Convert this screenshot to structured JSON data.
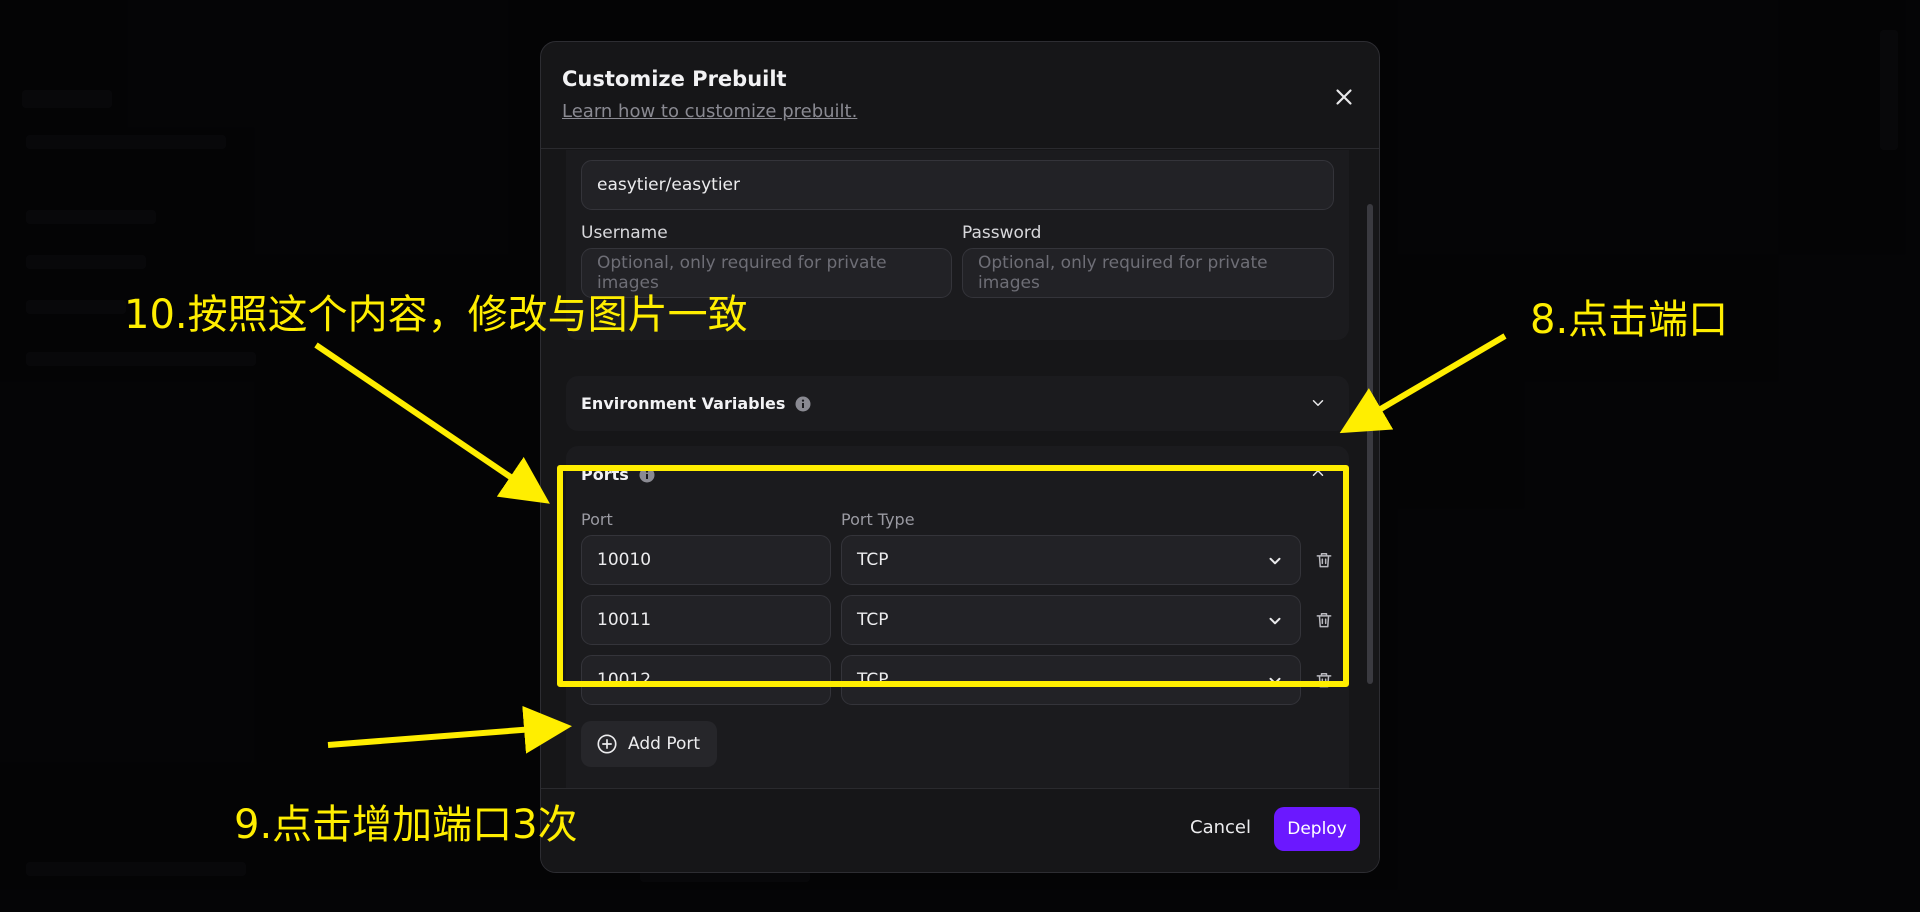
{
  "modal": {
    "title": "Customize Prebuilt",
    "help_link": "Learn how to customize prebuilt.",
    "image_value": "easytier/easytier",
    "username_label": "Username",
    "username_placeholder": "Optional, only required for private images",
    "password_label": "Password",
    "password_placeholder": "Optional, only required for private images",
    "env_section": "Environment Variables",
    "ports_section": "Ports",
    "port_col": "Port",
    "port_type_col": "Port Type",
    "ports": [
      {
        "port": "10010",
        "type": "TCP"
      },
      {
        "port": "10011",
        "type": "TCP"
      },
      {
        "port": "10012",
        "type": "TCP"
      }
    ],
    "add_port": "Add Port",
    "cancel": "Cancel",
    "deploy": "Deploy"
  },
  "annotations": {
    "step10": "10.按照这个内容，修改与图片一致",
    "step8": "8.点击端口",
    "step9": "9.点击增加端口3次"
  },
  "colors": {
    "accent": "#6b18ff",
    "annotation": "#ffee00"
  }
}
